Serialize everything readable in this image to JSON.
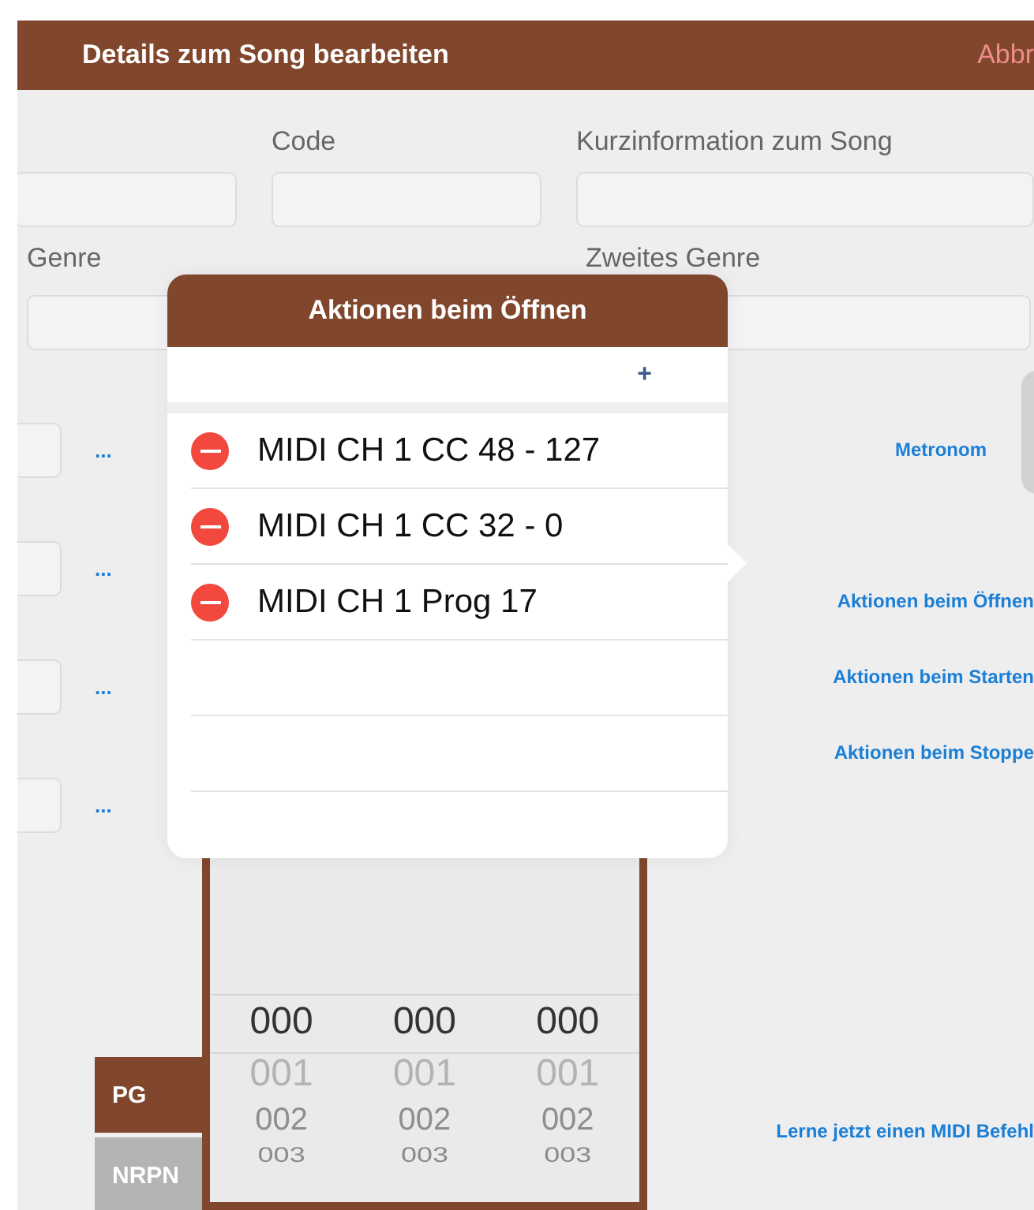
{
  "header": {
    "title": "Details zum Song bearbeiten",
    "cancel": "Abbr"
  },
  "form_row_1": [
    {
      "label": "Code"
    },
    {
      "label": "Kurzinformation zum Song"
    }
  ],
  "form_row_2": [
    {
      "label": "Genre"
    },
    {
      "label": "Zweites Genre"
    }
  ],
  "side_fields": [
    {
      "more": "..."
    },
    {
      "more": "..."
    },
    {
      "more": "..."
    },
    {
      "more": "..."
    }
  ],
  "side_links": [
    "Metronom",
    "Aktionen beim Öffnen",
    "Aktionen beim Starten",
    "Aktionen beim Stoppe"
  ],
  "learn_link": "Lerne jetzt einen MIDI Befehl",
  "modes": [
    {
      "label": "PG",
      "selected": true
    },
    {
      "label": "NRPN",
      "selected": false
    }
  ],
  "picker": {
    "columns": [
      [
        "000",
        "001",
        "002",
        "003"
      ],
      [
        "000",
        "001",
        "002",
        "003"
      ],
      [
        "000",
        "001",
        "002",
        "003"
      ]
    ]
  },
  "popover": {
    "title": "Aktionen beim Öffnen",
    "add": "+",
    "actions": [
      {
        "label": "MIDI CH 1 CC 48 - 127"
      },
      {
        "label": "MIDI CH 1 CC 32 - 0"
      },
      {
        "label": "MIDI CH 1 Prog 17"
      }
    ]
  }
}
